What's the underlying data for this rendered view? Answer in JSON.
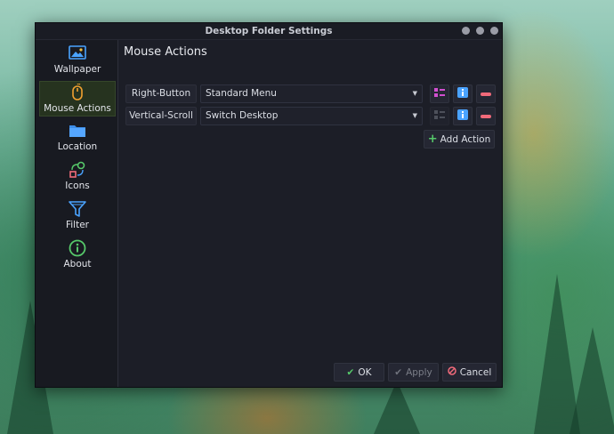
{
  "window": {
    "title": "Desktop Folder Settings"
  },
  "sidebar": {
    "items": [
      {
        "label": "Wallpaper",
        "icon": "wallpaper-icon",
        "active": false
      },
      {
        "label": "Mouse Actions",
        "icon": "mouse-icon",
        "active": true
      },
      {
        "label": "Location",
        "icon": "folder-icon",
        "active": false
      },
      {
        "label": "Icons",
        "icon": "icons-icon",
        "active": false
      },
      {
        "label": "Filter",
        "icon": "filter-icon",
        "active": false
      },
      {
        "label": "About",
        "icon": "info-icon",
        "active": false
      }
    ]
  },
  "main": {
    "title": "Mouse Actions",
    "actions": [
      {
        "trigger": "Right-Button",
        "action": "Standard Menu",
        "configure_enabled": true
      },
      {
        "trigger": "Vertical-Scroll",
        "action": "Switch Desktop",
        "configure_enabled": false
      }
    ],
    "add_label": "Add Action"
  },
  "footer": {
    "ok_label": "OK",
    "apply_label": "Apply",
    "cancel_label": "Cancel"
  },
  "colors": {
    "accent_green": "#56c96a",
    "remove_red": "#f06a7a",
    "info_blue": "#4aa3ff",
    "configure_magenta": "#d24fd0"
  }
}
